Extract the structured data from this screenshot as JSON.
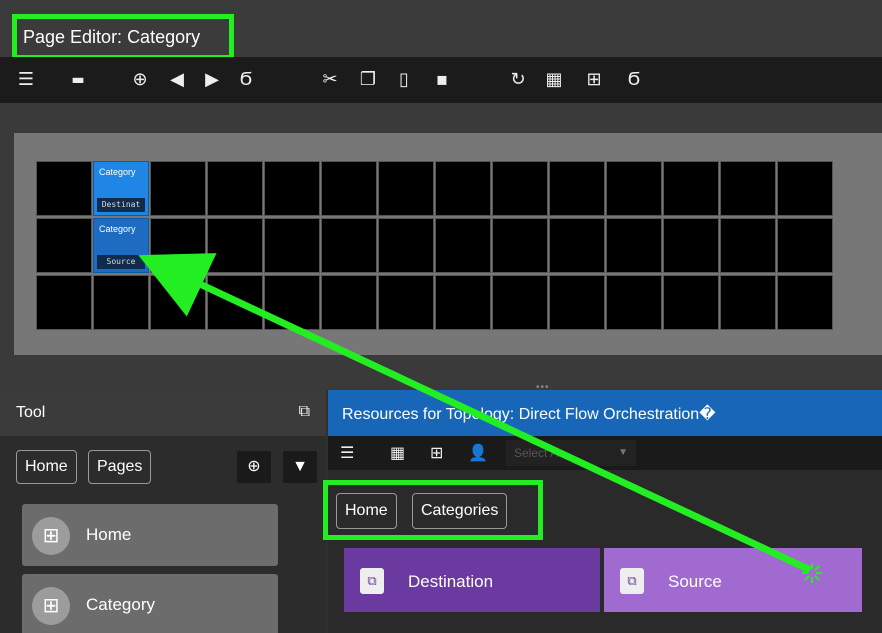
{
  "window": {
    "title": "Page Editor: Category"
  },
  "toolbar": {
    "icons": [
      "list-icon",
      "keyboard-icon",
      "add-icon",
      "move-left-icon",
      "move-right-icon",
      "script-icon",
      "cut-icon",
      "copy-icon",
      "paste-icon",
      "duplicate-icon",
      "refresh-icon",
      "grid-large-icon",
      "grid-small-icon",
      "script-alt-icon"
    ]
  },
  "canvas": {
    "buttons": [
      {
        "label": "Category",
        "sub": "Destinat"
      },
      {
        "label": "Category",
        "sub": "Source"
      }
    ]
  },
  "tool": {
    "title": "Tool",
    "breadcrumb": [
      "Home",
      "Pages"
    ],
    "pages": [
      "Home",
      "Category"
    ]
  },
  "resources": {
    "title": "Resources for Topology: Direct Flow Orchestration�",
    "select_placeholder": "Select A...",
    "breadcrumb": [
      "Home",
      "Categories"
    ],
    "categories": [
      {
        "label": "Destination",
        "color": "#6a3aa0"
      },
      {
        "label": "Source",
        "color": "#a06ad0"
      }
    ]
  },
  "colors": {
    "highlight": "#22ee22",
    "accent": "#1766b8"
  }
}
